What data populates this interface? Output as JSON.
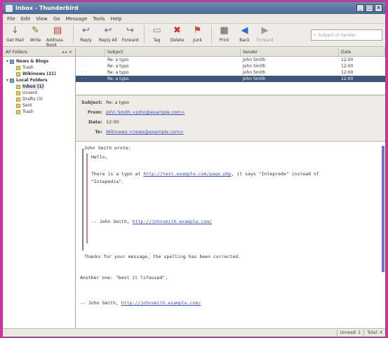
{
  "window": {
    "title": "Inbox - Thunderbird",
    "min": "_",
    "max": "□",
    "close": "×"
  },
  "menu": [
    "File",
    "Edit",
    "View",
    "Go",
    "Message",
    "Tools",
    "Help"
  ],
  "toolbar": [
    {
      "label": "Get Mail",
      "icon": "get-mail-icon",
      "glyph": "↓",
      "color": "#3a6fc0"
    },
    {
      "label": "Write",
      "icon": "pencil-icon",
      "glyph": "✎",
      "color": "#8a6a2a"
    },
    {
      "label": "Address Book",
      "icon": "address-book-icon",
      "glyph": "▤",
      "color": "#c03c30"
    },
    {
      "label": "Reply",
      "icon": "reply-icon",
      "glyph": "↩",
      "color": "#4c6a9a"
    },
    {
      "label": "Reply All",
      "icon": "reply-all-icon",
      "glyph": "↩",
      "color": "#4c6a9a"
    },
    {
      "label": "Forward",
      "icon": "forward-icon",
      "glyph": "↪",
      "color": "#4c6a9a"
    },
    {
      "label": "Tag",
      "icon": "tag-icon",
      "glyph": "▭",
      "color": "#6a8ab0"
    },
    {
      "label": "Delete",
      "icon": "delete-icon",
      "glyph": "✖",
      "color": "#d03228"
    },
    {
      "label": "Junk",
      "icon": "junk-icon",
      "glyph": "⚑",
      "color": "#c74a3a"
    },
    {
      "label": "Print",
      "icon": "print-icon",
      "glyph": "▦",
      "color": "#555"
    },
    {
      "label": "Back",
      "icon": "back-icon",
      "glyph": "◀",
      "color": "#2a6bd0"
    },
    {
      "label": "Forward",
      "icon": "next-icon",
      "glyph": "▶",
      "color": "#9a9a9a"
    }
  ],
  "search": {
    "placeholder": "Subject or Sender"
  },
  "folders": {
    "header": "All Folders",
    "nav": "◂ ▸ ✕",
    "items": [
      {
        "label": "News & Blogs",
        "depth": 0,
        "bold": true,
        "acct": true,
        "twisty": "▾"
      },
      {
        "label": "Trash",
        "depth": 1
      },
      {
        "label": "Wikinews (21)",
        "depth": 1,
        "bold": true
      },
      {
        "label": "Local Folders",
        "depth": 0,
        "bold": true,
        "acct": true,
        "twisty": "▾"
      },
      {
        "label": "Inbox (1)",
        "depth": 1,
        "bold": true,
        "selected": true
      },
      {
        "label": "Unsent",
        "depth": 1
      },
      {
        "label": "Drafts (3)",
        "depth": 1
      },
      {
        "label": "Sent",
        "depth": 1
      },
      {
        "label": "Trash",
        "depth": 1
      }
    ]
  },
  "thread": {
    "columns": [
      "",
      "Subject",
      "Sender",
      "Date"
    ],
    "rows": [
      {
        "subject": "Re: a typo",
        "sender": "John Smith",
        "date": "12:00"
      },
      {
        "subject": "Re: a typo",
        "sender": "John Smith",
        "date": "12:00"
      },
      {
        "subject": "Re: a typo",
        "sender": "John Smith",
        "date": "12:00"
      },
      {
        "subject": "Re: a typo",
        "sender": "John Smith",
        "date": "12:00",
        "selected": true
      }
    ]
  },
  "message": {
    "subject_label": "Subject:",
    "subject": "Re: a typo",
    "from_label": "From:",
    "from": "John Smith <john@example.com>",
    "date_label": "Date:",
    "date": "12:00",
    "to_label": "To:",
    "to": "Wikinews <news@example.com>",
    "body": {
      "attrib": "John Smith wrote:",
      "greeting": "Hello,",
      "typo_prefix": "There is a typo at",
      "typo_link": "http://test.example.com/page.php",
      "typo_mid": ", it says \"Inteprede\" instead of",
      "typo_line2": "\"Intepedia\".",
      "sig_prefix": "-- John Smith,",
      "sig_link": "http://johnsmith.example.com/",
      "thanks": "Thanks for your message, the spelling has been corrected.",
      "another": "Another one: \"best it lifeused\".",
      "sig2_prefix": "-- John Smith,",
      "sig2_link": "http://johnsmith.example.com/"
    }
  },
  "status": {
    "unread": "Unread: 1",
    "total": "Total: 4"
  }
}
